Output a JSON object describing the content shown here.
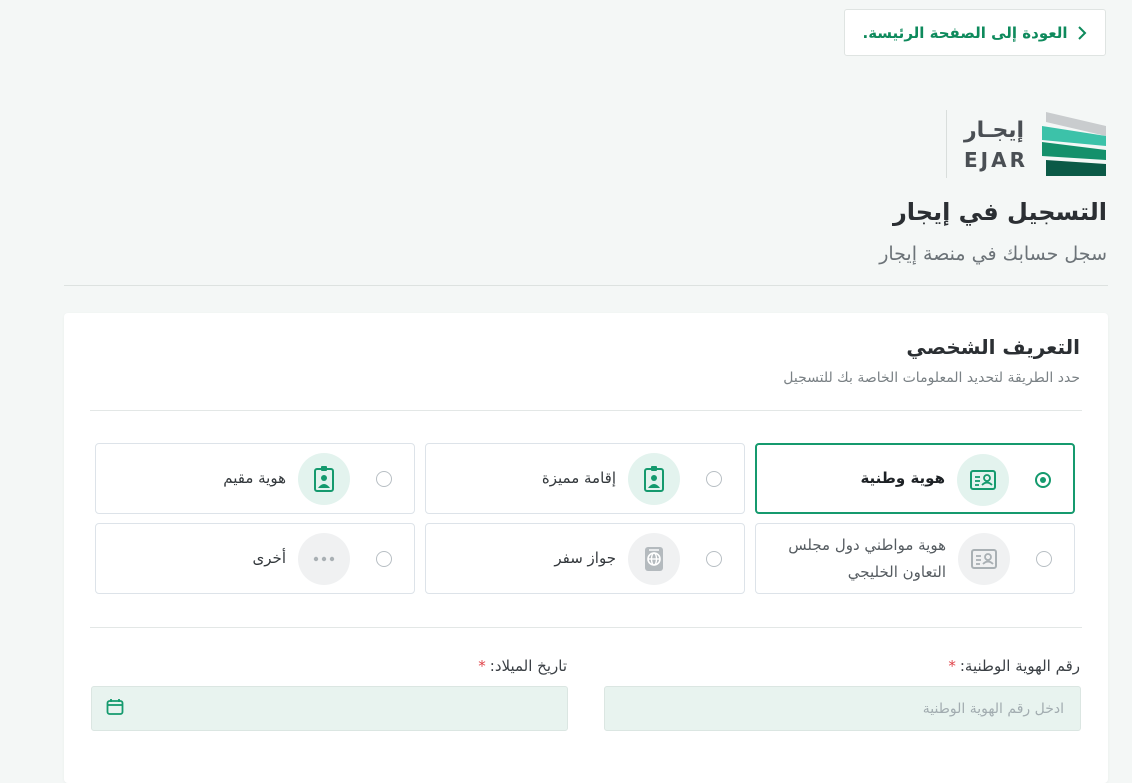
{
  "header": {
    "back_label": "العودة إلى الصفحة الرئيسة."
  },
  "logo": {
    "arabic": "إيجـار",
    "english": "EJAR"
  },
  "page": {
    "title": "التسجيل في إيجار",
    "subtitle": "سجل حسابك في منصة إيجار"
  },
  "card": {
    "title": "التعريف الشخصي",
    "subtitle": "حدد الطريقة لتحديد المعلومات الخاصة بك للتسجيل"
  },
  "id_options": [
    {
      "label": "هوية وطنية",
      "icon": "id-card-icon",
      "selected": true
    },
    {
      "label": "إقامة مميزة",
      "icon": "badge-id-icon",
      "selected": false
    },
    {
      "label": "هوية مقيم",
      "icon": "badge-id-icon",
      "selected": false
    },
    {
      "label": "هوية مواطني دول مجلس التعاون الخليجي",
      "icon": "id-card-icon",
      "selected": false
    },
    {
      "label": "جواز سفر",
      "icon": "passport-icon",
      "selected": false
    },
    {
      "label": "أخرى",
      "icon": "more-icon",
      "selected": false
    }
  ],
  "form": {
    "national_id_label": "رقم الهوية الوطنية:",
    "national_id_placeholder": "ادخل رقم الهوية الوطنية",
    "national_id_value": "",
    "birthdate_label": "تاريخ الميلاد:",
    "birthdate_value": "",
    "required_mark": "*"
  },
  "colors": {
    "brand": "#159a6e",
    "input_bg": "#e8f3ef",
    "required": "#e0444a"
  }
}
